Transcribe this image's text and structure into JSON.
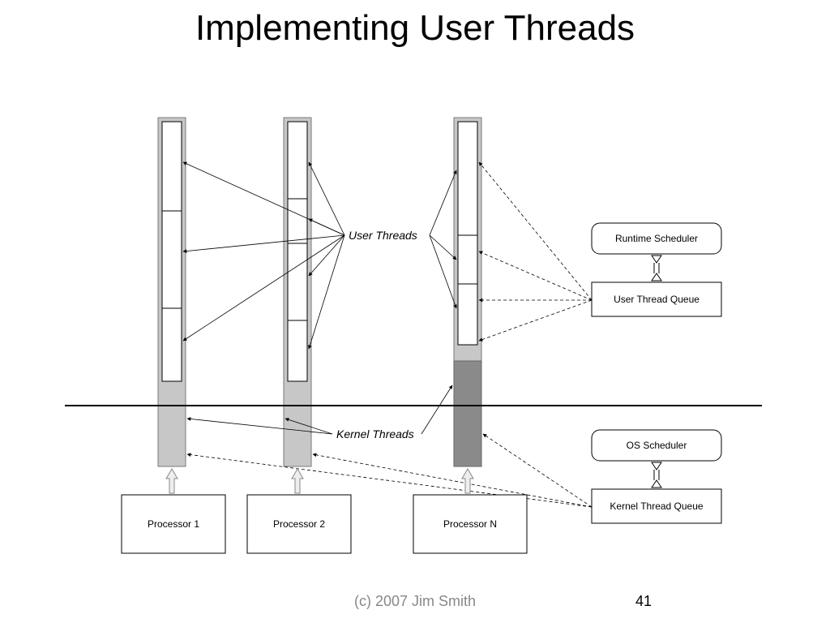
{
  "title": "Implementing User Threads",
  "labels": {
    "user_threads": "User Threads",
    "kernel_threads": "Kernel Threads"
  },
  "right_boxes": {
    "runtime_scheduler": "Runtime Scheduler",
    "user_thread_queue": "User Thread Queue",
    "os_scheduler": "OS Scheduler",
    "kernel_thread_queue": "Kernel Thread Queue"
  },
  "processors": {
    "p1": "Processor 1",
    "p2": "Processor 2",
    "pn": "Processor N"
  },
  "footer": {
    "copyright": "(c) 2007 Jim Smith",
    "page": "41"
  }
}
